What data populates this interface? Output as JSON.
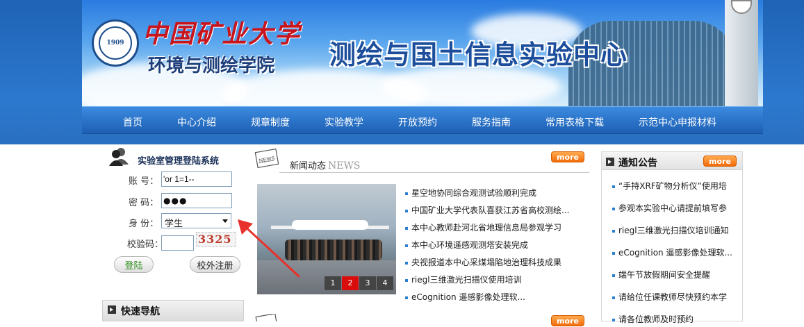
{
  "header": {
    "university_name": "中国矿业大学",
    "college_name": "环境与测绘学院",
    "center_title": "测绘与国土信息实验中心",
    "logo_year": "1909"
  },
  "nav": {
    "items": [
      "首页",
      "中心介绍",
      "规章制度",
      "实验教学",
      "开放预约",
      "服务指南",
      "常用表格下载",
      "示范中心申报材料"
    ]
  },
  "login": {
    "title": "实验室管理登陆系统",
    "account_label": "账  号：",
    "account_value": "'or 1=1--",
    "password_label": "密  码：",
    "password_value": "●●●",
    "identity_label": "身  份：",
    "identity_selected": "学生",
    "captcha_label": "校验码：",
    "captcha_value": "",
    "captcha_code": "3325",
    "login_button": "登陆",
    "register_button": "校外注册"
  },
  "quick_nav": {
    "title": "快速导航"
  },
  "news": {
    "title": "新闻动态",
    "title_en": "NEWS",
    "more_label": "more",
    "items": [
      "星空地协同综合观测试验顺利完成",
      "中国矿业大学代表队喜获江苏省高校测绘...",
      "本中心教师赴河北省地理信息局参观学习",
      "本中心环境遥感观测塔安装完成",
      "央视报道本中心采煤塌陷地治理科技成果",
      "riegl三维激光扫描仪使用培训",
      "eCognition 遥感影像处理软..."
    ],
    "pager": [
      "1",
      "2",
      "3",
      "4"
    ],
    "pager_active": 1
  },
  "notice": {
    "title": "通知公告",
    "more_label": "more",
    "items": [
      "“手持XRF矿物分析仪”使用培",
      "参观本实验中心请提前填写参",
      "riegl三维激光扫描仪培训通知",
      "eCognition 遥感影像处理软...",
      "端午节放假期间安全提醒",
      "请给位任课教师尽快预约本学",
      "请各位教师及时预约"
    ]
  },
  "second_section": {
    "more_label": "more"
  },
  "colors": {
    "nav_blue": "#1d5fb3",
    "more_orange": "#f36c0a",
    "annotation_red": "#e8312b",
    "bullet_blue": "#2b7fd0"
  }
}
